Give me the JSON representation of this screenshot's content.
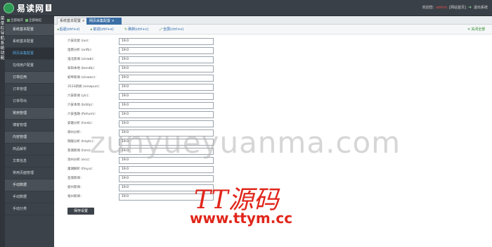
{
  "header": {
    "logo_text": "易读网",
    "logo_tag": "管理",
    "welcome": "欢迎您:",
    "username": "admin",
    "site_home": "[网站首页]",
    "logout": "退出系统"
  },
  "left_strip": [
    "菜",
    "单",
    "栏",
    "导",
    "航",
    "",
    "系",
    "统",
    "",
    "功",
    "能"
  ],
  "sidebar": {
    "tabs": [
      "全部展开",
      "全部收起"
    ],
    "items": [
      {
        "label": "系统基本配置",
        "type": "group"
      },
      {
        "label": "系统基本配置",
        "type": "item"
      },
      {
        "label": "网页采集配置",
        "type": "active"
      },
      {
        "label": "在线用户配置",
        "type": "item"
      },
      {
        "label": "订单应用",
        "type": "group"
      },
      {
        "label": "订单管理",
        "type": "item"
      },
      {
        "label": "订单导出",
        "type": "item"
      },
      {
        "label": "常用管理",
        "type": "group"
      },
      {
        "label": "博客管理",
        "type": "item"
      },
      {
        "label": "内容管理",
        "type": "group"
      },
      {
        "label": "商品解析",
        "type": "item"
      },
      {
        "label": "文章信息",
        "type": "item"
      },
      {
        "label": "常用页面管理",
        "type": "item"
      },
      {
        "label": "手动数据",
        "type": "group"
      },
      {
        "label": "手动数据",
        "type": "item"
      },
      {
        "label": "手动分类",
        "type": "item"
      }
    ]
  },
  "tabs": [
    {
      "label": "系统基本配置 ×"
    },
    {
      "label": "网页采集配置 ×"
    }
  ],
  "toolbar": {
    "back": "后退(ctrl+z)",
    "forward": "前进(ctrl+x)",
    "refresh": "刷新(ctrl+c)",
    "fullscreen": "全屏(ctrl+v)",
    "close_all": "关闭全部"
  },
  "form": {
    "rows": [
      {
        "label": "六安房屋 (ias)：",
        "value": "19.0"
      },
      {
        "label": "淮南分析 (anfb)：",
        "value": "19.0"
      },
      {
        "label": "淮北新闻 (xinwb)：",
        "value": "19.0"
      },
      {
        "label": "阜阳本地 (bendb)：",
        "value": "19.0"
      },
      {
        "label": "蚌埠新闻 (xinwen)：",
        "value": "19.0"
      },
      {
        "label": "3533新闻 (xinwpun)：",
        "value": "19.0"
      },
      {
        "label": "六安新闻 (ylc)：",
        "value": "19.0"
      },
      {
        "label": "六安本地 (bdzlp)：",
        "value": "19.0"
      },
      {
        "label": "六安金融 (fiehum)：",
        "value": "19.0"
      },
      {
        "label": "安徽分析 (hsnb)：",
        "value": "19.0"
      },
      {
        "label": "滁州分析：",
        "value": "19.0"
      },
      {
        "label": "铜陵分析 (tmptc)：",
        "value": "19.0"
      },
      {
        "label": "芜湖新闻 (hzro)：",
        "value": "19.0"
      },
      {
        "label": "池州分析 (ecs)：",
        "value": "19.0"
      },
      {
        "label": "巢湖解析 (fmyu)：",
        "value": "19.0"
      },
      {
        "label": "宣城新闻：",
        "value": "19.0"
      },
      {
        "label": "宿州新闻：",
        "value": "19.0"
      },
      {
        "label": "亳州新闻：",
        "value": "19.0"
      }
    ],
    "save_label": "保存设置"
  },
  "watermark": {
    "domain_text": "zunyueyuanma.com",
    "logo_text": "TT源码",
    "url_text": "www.ttym.cc"
  }
}
